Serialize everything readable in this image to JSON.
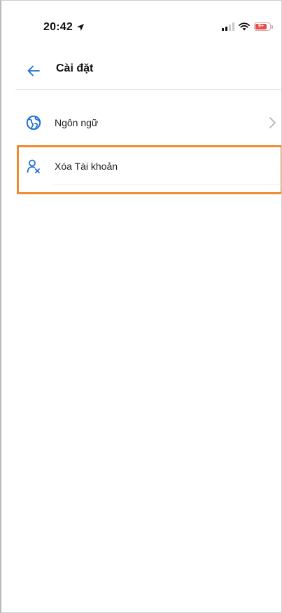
{
  "status_bar": {
    "time": "20:42",
    "battery_label": "9+"
  },
  "header": {
    "title": "Cài đặt"
  },
  "settings": {
    "items": [
      {
        "label": "Ngôn ngữ",
        "icon": "globe-icon",
        "has_chevron": true
      },
      {
        "label": "Xóa Tài khoản",
        "icon": "delete-user-icon",
        "has_chevron": false,
        "highlighted": true
      }
    ]
  },
  "colors": {
    "accent": "#1f6fd1",
    "highlight": "#f28a2e",
    "battery_low": "#e84b4b"
  }
}
